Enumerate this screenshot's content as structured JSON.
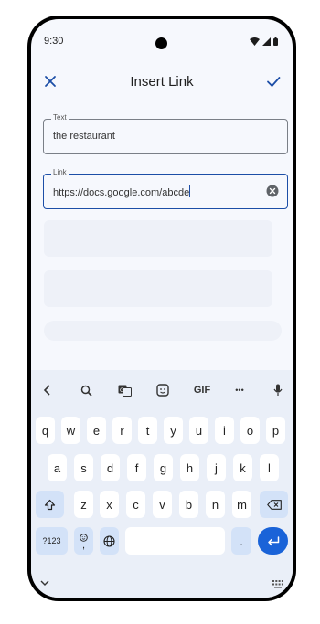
{
  "status_bar": {
    "time": "9:30"
  },
  "app_bar": {
    "title": "Insert Link"
  },
  "form": {
    "text_field": {
      "label": "Text",
      "value": "the restaurant"
    },
    "link_field": {
      "label": "Link",
      "value": "https://docs.google.com/abcde"
    }
  },
  "keyboard": {
    "toolbar": {
      "gif_label": "GIF",
      "more_label": "•••"
    },
    "row1": [
      "q",
      "w",
      "e",
      "r",
      "t",
      "y",
      "u",
      "i",
      "o",
      "p"
    ],
    "row2": [
      "a",
      "s",
      "d",
      "f",
      "g",
      "h",
      "j",
      "k",
      "l"
    ],
    "row3": [
      "z",
      "x",
      "c",
      "v",
      "b",
      "n",
      "m"
    ],
    "symbols_label": "?123",
    "period_label": ".",
    "emoji_comma_label": ","
  },
  "colors": {
    "accent": "#1c4ea7",
    "enter_key": "#1a63d8",
    "background": "#f6f8fd"
  },
  "icons": [
    "close-icon",
    "check-icon",
    "clear-icon",
    "back-chevron-icon",
    "search-icon",
    "translate-icon",
    "sticker-icon",
    "mic-icon",
    "shift-icon",
    "backspace-icon",
    "globe-icon",
    "enter-icon",
    "hide-keyboard-icon",
    "keyboard-switch-icon"
  ]
}
